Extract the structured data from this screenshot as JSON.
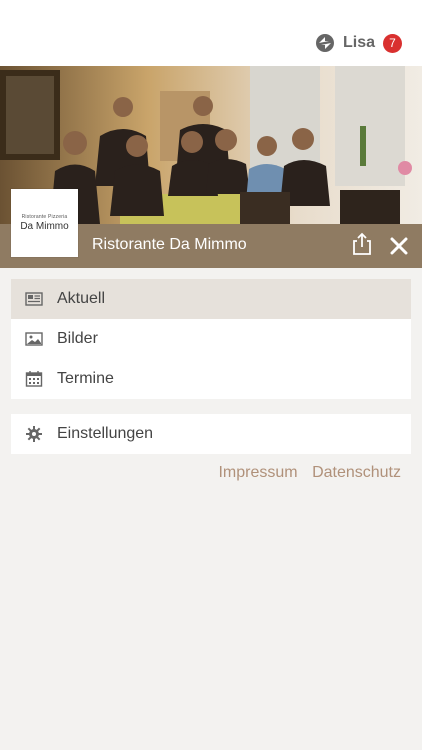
{
  "user": {
    "name": "Lisa",
    "badge_count": "7"
  },
  "restaurant": {
    "name": "Ristorante Da Mimmo",
    "logo_small": "Ristorante Pizzeria",
    "logo_big": "Da Mimmo"
  },
  "menu": {
    "primary": [
      {
        "label": "Aktuell",
        "icon": "newspaper-icon",
        "active": true
      },
      {
        "label": "Bilder",
        "icon": "image-icon",
        "active": false
      },
      {
        "label": "Termine",
        "icon": "calendar-icon",
        "active": false
      }
    ],
    "secondary": [
      {
        "label": "Einstellungen",
        "icon": "gear-icon"
      }
    ]
  },
  "footer": {
    "impressum": "Impressum",
    "datenschutz": "Datenschutz"
  },
  "colors": {
    "brand": "#8f7b62",
    "active_bg": "#e6e1db",
    "link": "#b0917a",
    "badge": "#d9302f"
  }
}
